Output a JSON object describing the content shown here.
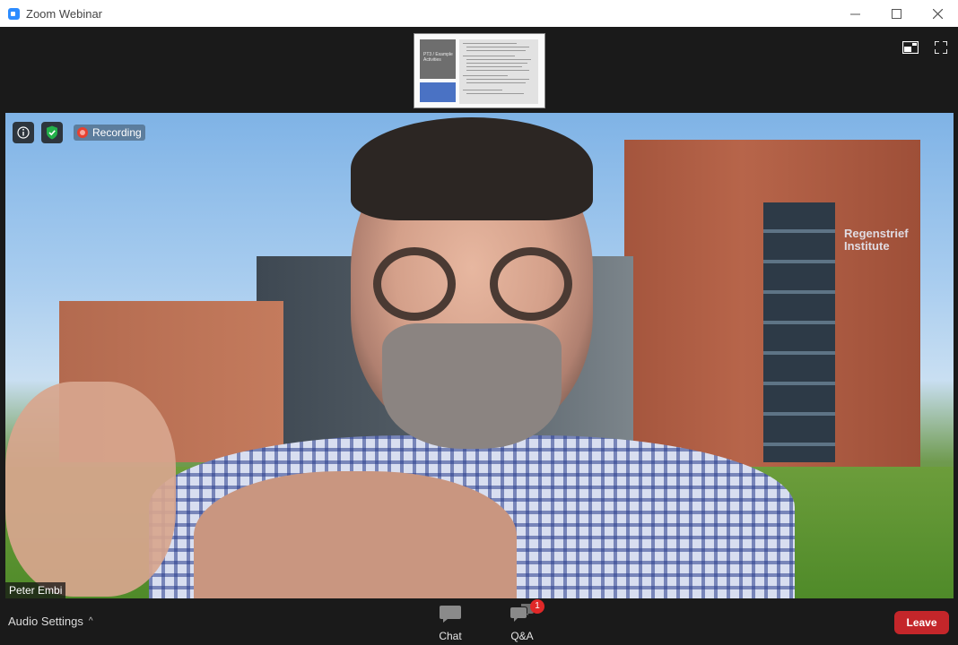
{
  "window": {
    "title": "Zoom Webinar"
  },
  "share": {
    "slide_heading": "PT3 / Example Activities"
  },
  "video": {
    "participant_name": "Peter Embi",
    "recording_label": "Recording",
    "background_sign": "Regenstrief Institute"
  },
  "toolbar": {
    "audio_settings_label": "Audio Settings",
    "chat_label": "Chat",
    "qa_label": "Q&A",
    "qa_badge": "1",
    "leave_label": "Leave"
  },
  "colors": {
    "leave": "#c4262a",
    "badge": "#e02828",
    "recording": "#e8402f",
    "shield": "#23b04a",
    "zoom_blue": "#2d8cff"
  }
}
